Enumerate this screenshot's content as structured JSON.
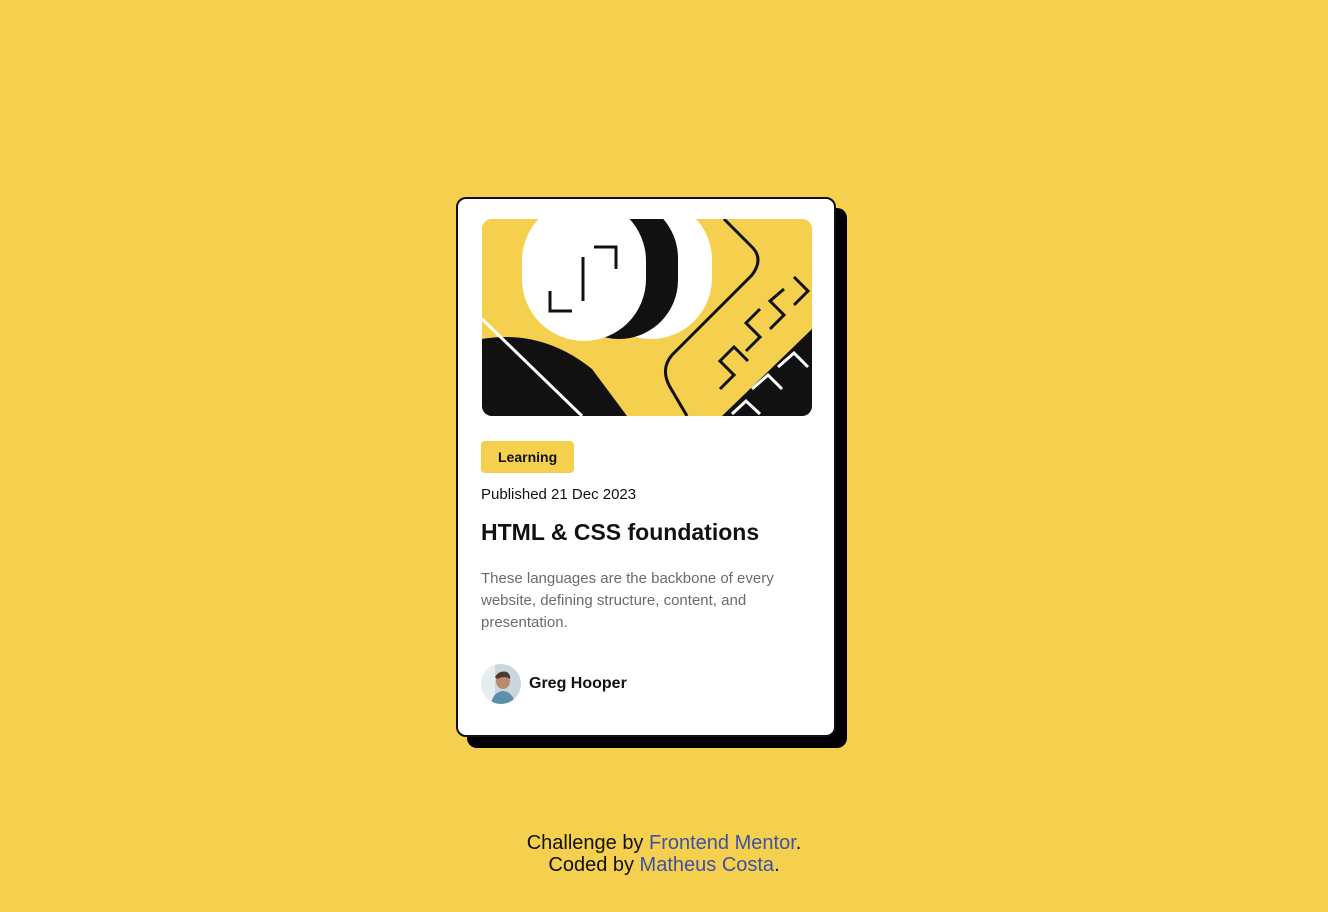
{
  "card": {
    "image_alt": "Illustration",
    "tag": "Learning",
    "published": "Published 21 Dec 2023",
    "title": "HTML & CSS foundations",
    "description": "These languages are the backbone of every website, defining structure, content, and presentation.",
    "author": {
      "name": "Greg Hooper"
    }
  },
  "attribution": {
    "challenge_prefix": "Challenge by ",
    "challenge_link": "Frontend Mentor",
    "challenge_suffix": ".",
    "coded_prefix": "Coded by ",
    "coded_link": "Matheus Costa",
    "coded_suffix": "."
  },
  "colors": {
    "background": "#F4D04E",
    "card": "#FFFFFF",
    "shadow": "#000000",
    "text": "#111111",
    "muted": "#6B6B6B",
    "link": "#3E52A3"
  }
}
